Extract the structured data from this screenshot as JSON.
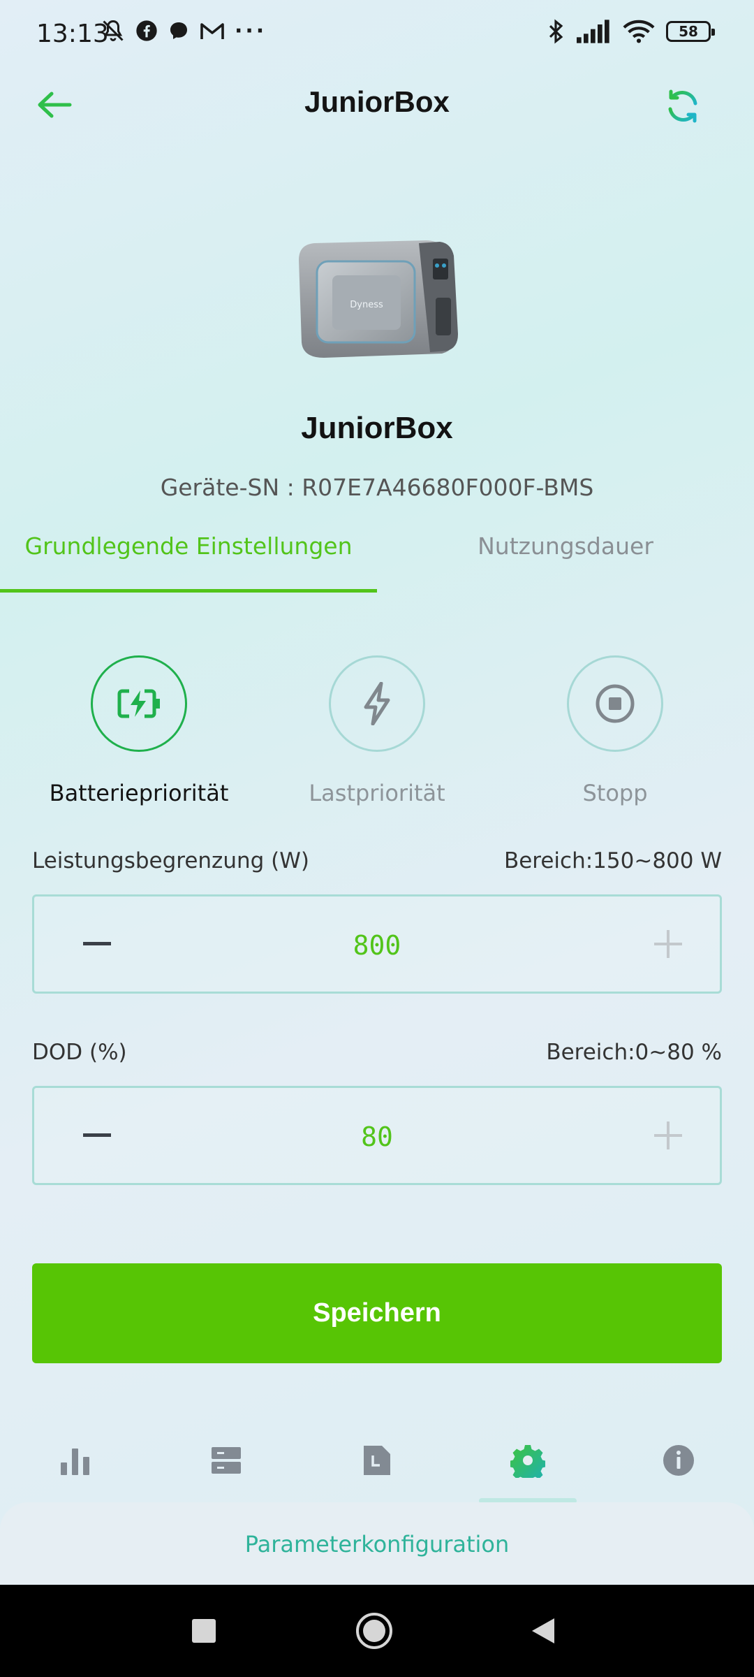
{
  "status_bar": {
    "time": "13:13",
    "battery_level": "58",
    "left_icons": [
      "bell-off-icon",
      "facebook-icon",
      "messenger-icon",
      "gmail-icon",
      "more-dots-icon"
    ],
    "right_icons": [
      "bluetooth-icon",
      "signal-icon",
      "wifi-icon",
      "battery-icon"
    ]
  },
  "header": {
    "title": "JuniorBox",
    "back_icon": "arrow-left-icon",
    "refresh_icon": "refresh-icon",
    "accent_color": "#2fbf4a"
  },
  "device": {
    "name": "JuniorBox",
    "serial_label": "Geräte-SN : R07E7A46680F000F-BMS",
    "brand_on_image": "Dyness"
  },
  "tabs": [
    {
      "label": "Grundlegende Einstellungen",
      "active": true
    },
    {
      "label": "Nutzungsdauer",
      "active": false
    }
  ],
  "modes": [
    {
      "label": "Batteriepriorität",
      "icon": "battery-charging-icon",
      "active": true
    },
    {
      "label": "Lastpriorität",
      "icon": "lightning-icon",
      "active": false
    },
    {
      "label": "Stopp",
      "icon": "stop-icon",
      "active": false
    }
  ],
  "power_limit": {
    "label": "Leistungsbegrenzung (W)",
    "range": "Bereich:150~800 W",
    "value": "800"
  },
  "dod": {
    "label": "DOD (%)",
    "range": "Bereich:0~80 %",
    "value": "80"
  },
  "save_button": {
    "label": "Speichern",
    "color": "#57c505"
  },
  "bottom_nav": {
    "items": [
      {
        "icon": "bar-chart-icon",
        "active": false
      },
      {
        "icon": "storage-icon",
        "active": false
      },
      {
        "icon": "document-icon",
        "active": false
      },
      {
        "icon": "settings-gear-icon",
        "active": true
      },
      {
        "icon": "info-icon",
        "active": false
      }
    ],
    "sheet_label": "Parameterkonfiguration"
  },
  "system_nav": [
    "square-recents-icon",
    "circle-home-icon",
    "triangle-back-icon"
  ]
}
